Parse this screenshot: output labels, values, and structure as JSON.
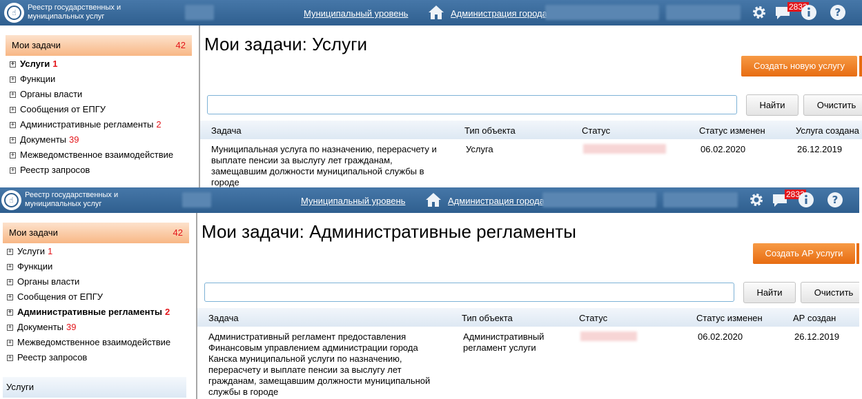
{
  "screens": [
    {
      "topbar": {
        "app_title": "Реестр государственных и муниципальных услуг",
        "nav_level": "Муниципальный уровень",
        "nav_admin": "Администрация города",
        "notification_count": "2832",
        "icons": [
          "logo-icon",
          "home-icon",
          "gear-icon",
          "messages-icon",
          "info-icon",
          "help-icon"
        ]
      },
      "sidebar": {
        "header_label": "Мои задачи",
        "header_count": "42",
        "items": [
          {
            "label": "Услуги",
            "count": "1"
          },
          {
            "label": "Функции",
            "count": ""
          },
          {
            "label": "Органы власти",
            "count": ""
          },
          {
            "label": "Сообщения от ЕПГУ",
            "count": ""
          },
          {
            "label": "Административные регламенты",
            "count": "2"
          },
          {
            "label": "Документы",
            "count": "39"
          },
          {
            "label": "Межведомственное взаимодействие",
            "count": ""
          },
          {
            "label": "Реестр запросов",
            "count": ""
          }
        ],
        "active_index": 0
      },
      "main": {
        "title": "Мои задачи: Услуги",
        "create_button": "Создать новую услугу",
        "search_placeholder": "",
        "find_button": "Найти",
        "clear_button": "Очистить",
        "columns": [
          "Задача",
          "Тип объекта",
          "Статус",
          "Статус изменен",
          "Услуга создана"
        ],
        "rows": [
          {
            "task": "Муниципальная услуга по назначению, перерасчету и выплате пенсии за выслугу лет гражданам, замещавшим должности муниципальной службы в городе",
            "type": "Услуга",
            "status_changed": "06.02.2020",
            "created": "26.12.2019"
          }
        ]
      }
    },
    {
      "topbar": {
        "app_title": "Реестр государственных и муниципальных услуг",
        "nav_level": "Муниципальный уровень",
        "nav_admin": "Администрация города",
        "notification_count": "2832"
      },
      "sidebar": {
        "header_label": "Мои задачи",
        "header_count": "42",
        "items": [
          {
            "label": "Услуги",
            "count": "1"
          },
          {
            "label": "Функции",
            "count": ""
          },
          {
            "label": "Органы власти",
            "count": ""
          },
          {
            "label": "Сообщения от ЕПГУ",
            "count": ""
          },
          {
            "label": "Административные регламенты",
            "count": "2"
          },
          {
            "label": "Документы",
            "count": "39"
          },
          {
            "label": "Межведомственное взаимодействие",
            "count": ""
          },
          {
            "label": "Реестр запросов",
            "count": ""
          }
        ],
        "active_index": 4,
        "subsection_label": "Услуги"
      },
      "main": {
        "title": "Мои задачи: Административные регламенты",
        "create_button": "Создать АР услуги",
        "search_placeholder": "",
        "find_button": "Найти",
        "clear_button": "Очистить",
        "columns": [
          "Задача",
          "Тип объекта",
          "Статус",
          "Статус изменен",
          "АР создан"
        ],
        "rows": [
          {
            "task": "Административный регламент предоставления Финансовым управлением администрации города Канска муниципальной услуги по назначению, перерасчету и выплате пенсии за выслугу лет гражданам, замещавшим должности муниципальной службы в городе",
            "type": "Административный регламент услуги",
            "status_changed": "06.02.2020",
            "created": "26.12.2019"
          }
        ]
      }
    }
  ],
  "colors": {
    "topbar": "#3a6a9a",
    "accent_orange": "#e76c11",
    "badge_red": "#e3161b",
    "search_border": "#7db2d6"
  }
}
